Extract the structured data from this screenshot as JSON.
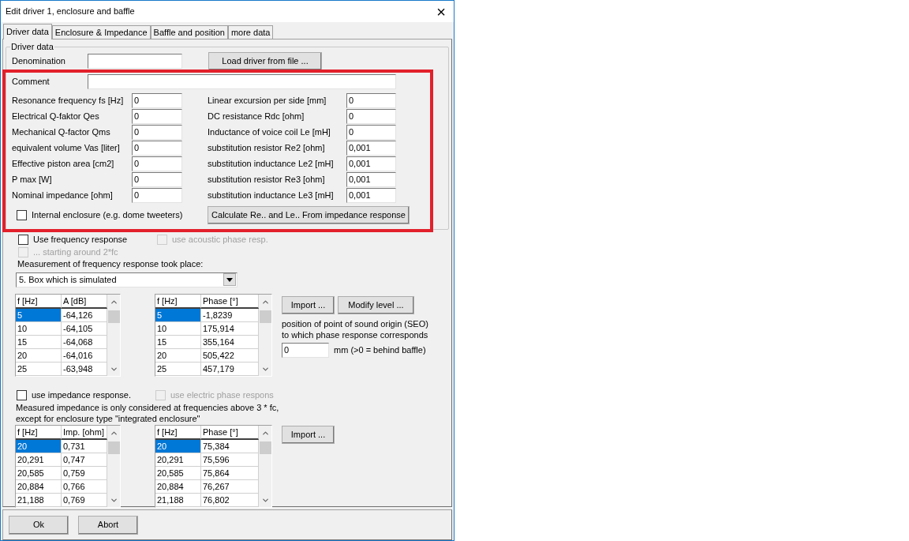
{
  "window": {
    "title": "Edit driver 1, enclosure and baffle",
    "close": "×"
  },
  "tabs": [
    {
      "label": "Driver data",
      "selected": true
    },
    {
      "label": "Enclosure & Impedance",
      "selected": false
    },
    {
      "label": "Baffle and position",
      "selected": false
    },
    {
      "label": "more data",
      "selected": false
    }
  ],
  "driver_data": {
    "title": "Driver data",
    "denomination": {
      "label": "Denomination"
    },
    "load_button": "Load driver from file ...",
    "comment": {
      "label": "Comment"
    },
    "left_params": [
      {
        "label": "Resonance frequency fs [Hz]",
        "value": "0"
      },
      {
        "label": "Electrical Q-faktor Qes",
        "value": "0"
      },
      {
        "label": "Mechanical Q-factor Qms",
        "value": "0"
      },
      {
        "label": "equivalent volume Vas [liter]",
        "value": "0"
      },
      {
        "label": "Effective piston area [cm2]",
        "value": "0"
      },
      {
        "label": "P max [W]",
        "value": "0"
      },
      {
        "label": "Nominal impedance [ohm]",
        "value": "0"
      }
    ],
    "right_params": [
      {
        "label": "Linear excursion per side [mm]",
        "value": "0"
      },
      {
        "label": "DC resistance Rdc [ohm]",
        "value": "0"
      },
      {
        "label": "Inductance of voice coil Le [mH]",
        "value": "0"
      },
      {
        "label": "substitution resistor Re2 [ohm]",
        "value": "0,001"
      },
      {
        "label": "substitution inductance Le2 [mH]",
        "value": "0,001"
      },
      {
        "label": "substitution resistor Re3 [ohm]",
        "value": "0,001"
      },
      {
        "label": "substitution inductance Le3 [mH]",
        "value": "0,001"
      }
    ],
    "internal_enclosure": {
      "label": "Internal enclosure (e.g. dome tweeters)",
      "checked": false
    },
    "calculate_button": "Calculate Re.. and Le.. From impedance response"
  },
  "frequency": {
    "use_frequency_response": {
      "label": "Use frequency response",
      "checked": false,
      "disabled": false
    },
    "use_acoustic_phase": {
      "label": "use acoustic phase resp.",
      "checked": false,
      "disabled": true
    },
    "starting_around": {
      "label": "... starting around 2*fc",
      "checked": false,
      "disabled": true
    },
    "measurement_label": "Measurement of frequency response took place:",
    "measurement_dropdown": "5. Box which is simulated",
    "amplitude_table": {
      "columns": [
        "f [Hz]",
        "A [dB]"
      ],
      "rows": [
        {
          "cells": [
            "5",
            "-64,126"
          ],
          "selected": true
        },
        {
          "cells": [
            "10",
            "-64,105"
          ],
          "selected": false
        },
        {
          "cells": [
            "15",
            "-64,068"
          ],
          "selected": false
        },
        {
          "cells": [
            "20",
            "-64,016"
          ],
          "selected": false
        },
        {
          "cells": [
            "25",
            "-63,948"
          ],
          "selected": false
        }
      ]
    },
    "phase_table": {
      "columns": [
        "f [Hz]",
        "Phase [°]"
      ],
      "rows": [
        {
          "cells": [
            "5",
            "-1,8239"
          ],
          "selected": true
        },
        {
          "cells": [
            "10",
            "175,914"
          ],
          "selected": false
        },
        {
          "cells": [
            "15",
            "355,164"
          ],
          "selected": false
        },
        {
          "cells": [
            "20",
            "505,422"
          ],
          "selected": false
        },
        {
          "cells": [
            "25",
            "457,179"
          ],
          "selected": false
        }
      ]
    },
    "import_button": "Import ...",
    "modify_button": "Modify level ...",
    "seo_text": [
      "position of point of sound origin (SEO)",
      "to which phase response corresponds"
    ],
    "seo_value": "0",
    "seo_unit": "mm (>0 = behind baffle)"
  },
  "impedance": {
    "use_impedance": {
      "label": "use impedance response.",
      "checked": false,
      "disabled": false
    },
    "use_electric_phase": {
      "label": "use electric phase respons",
      "checked": false,
      "disabled": true
    },
    "note": [
      "Measured impedance is only considered at frequencies above 3 * fc,",
      "except for enclosure type \"integrated enclosure\""
    ],
    "impedance_table": {
      "columns": [
        "f [Hz]",
        "Imp. [ohm]"
      ],
      "rows": [
        {
          "cells": [
            "20",
            "0,731"
          ],
          "selected": true
        },
        {
          "cells": [
            "20,291",
            "0,747"
          ],
          "selected": false
        },
        {
          "cells": [
            "20,585",
            "0,759"
          ],
          "selected": false
        },
        {
          "cells": [
            "20,884",
            "0,766"
          ],
          "selected": false
        },
        {
          "cells": [
            "21,188",
            "0,769"
          ],
          "selected": false
        }
      ]
    },
    "phase_table": {
      "columns": [
        "f [Hz]",
        "Phase [°]"
      ],
      "rows": [
        {
          "cells": [
            "20",
            "75,384"
          ],
          "selected": true
        },
        {
          "cells": [
            "20,291",
            "75,596"
          ],
          "selected": false
        },
        {
          "cells": [
            "20,585",
            "75,864"
          ],
          "selected": false
        },
        {
          "cells": [
            "20,884",
            "76,267"
          ],
          "selected": false
        },
        {
          "cells": [
            "21,188",
            "76,802"
          ],
          "selected": false
        }
      ]
    },
    "import_button": "Import ..."
  },
  "buttons": [
    "Ok",
    "Abort"
  ]
}
